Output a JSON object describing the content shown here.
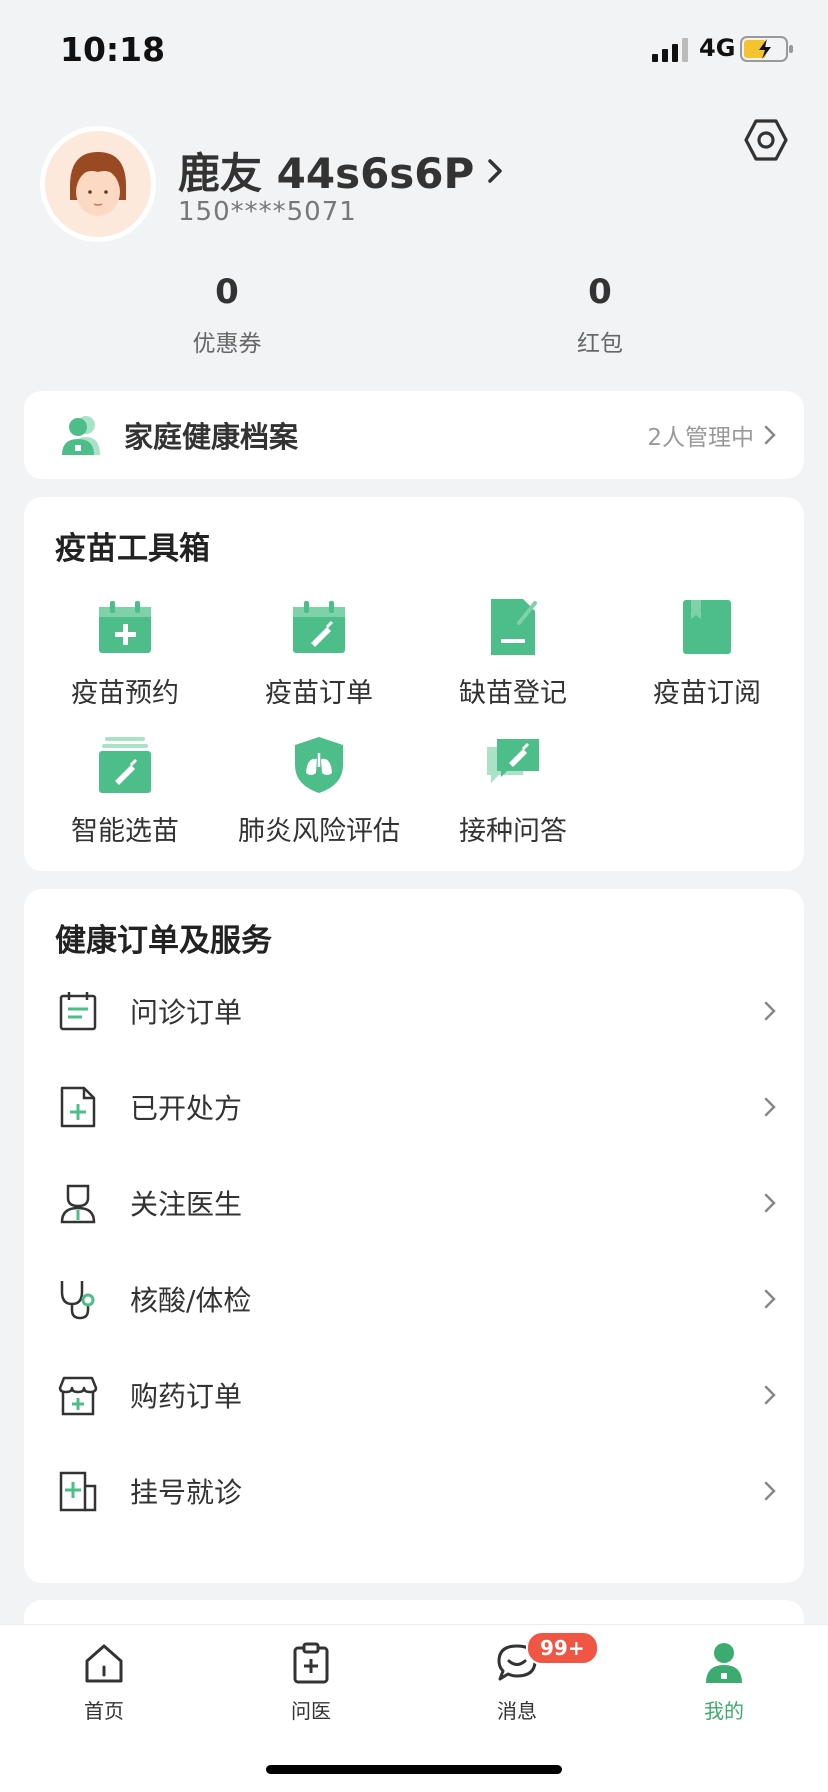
{
  "status_bar": {
    "time": "10:18",
    "network": "4G"
  },
  "profile": {
    "nickname": "鹿友 44s6s6P",
    "phone": "150****5071"
  },
  "stats": [
    {
      "value": "0",
      "label": "优惠券"
    },
    {
      "value": "0",
      "label": "红包"
    }
  ],
  "family_record": {
    "title": "家庭健康档案",
    "status": "2人管理中"
  },
  "vaccine_toolbox": {
    "title": "疫苗工具箱",
    "items": [
      {
        "label": "疫苗预约",
        "icon": "calendar-plus-icon"
      },
      {
        "label": "疫苗订单",
        "icon": "calendar-syringe-icon"
      },
      {
        "label": "缺苗登记",
        "icon": "document-edit-icon"
      },
      {
        "label": "疫苗订阅",
        "icon": "bookmark-book-icon"
      },
      {
        "label": "智能选苗",
        "icon": "stacked-syringe-icon"
      },
      {
        "label": "肺炎风险评估",
        "icon": "shield-lungs-icon"
      },
      {
        "label": "接种问答",
        "icon": "chat-syringe-icon"
      }
    ]
  },
  "services": {
    "title": "健康订单及服务",
    "items": [
      {
        "label": "问诊订单",
        "icon": "clipboard-calendar-icon"
      },
      {
        "label": "已开处方",
        "icon": "prescription-file-icon"
      },
      {
        "label": "关注医生",
        "icon": "doctor-icon"
      },
      {
        "label": "核酸/体检",
        "icon": "stethoscope-icon"
      },
      {
        "label": "购药订单",
        "icon": "pharmacy-store-icon"
      },
      {
        "label": "挂号就诊",
        "icon": "hospital-icon"
      }
    ]
  },
  "tabbar": {
    "items": [
      {
        "label": "首页",
        "icon": "home-icon"
      },
      {
        "label": "问医",
        "icon": "medical-kit-icon"
      },
      {
        "label": "消息",
        "icon": "chat-bubble-icon"
      },
      {
        "label": "我的",
        "icon": "user-icon"
      }
    ],
    "message_badge": "99+",
    "active_index": 3
  },
  "colors": {
    "accent": "#3cab6f",
    "icon_green": "#4dbd8a",
    "badge": "#f05643",
    "background": "#f2f3f5"
  }
}
